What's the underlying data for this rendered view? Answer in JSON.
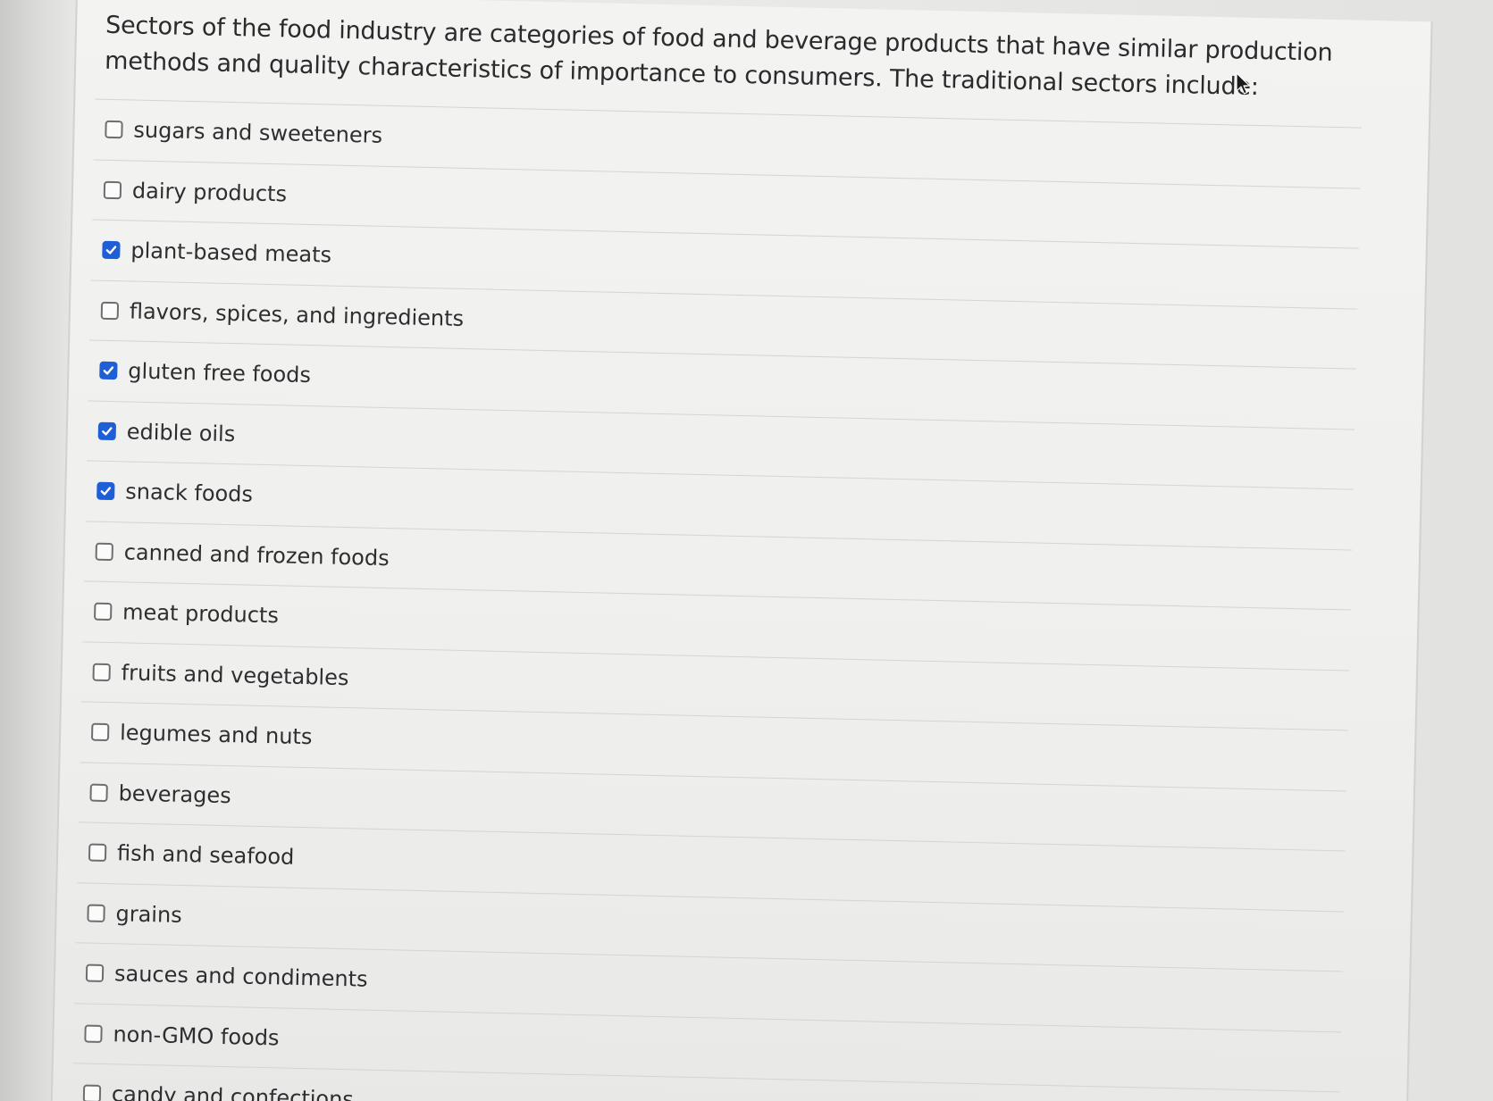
{
  "question": {
    "text": "Sectors of the food industry are categories of food and beverage products that have similar production methods and quality characteristics of importance to consumers.  The traditional sectors include:"
  },
  "options": [
    {
      "label": "sugars and sweeteners",
      "checked": false
    },
    {
      "label": "dairy products",
      "checked": false
    },
    {
      "label": "plant-based meats",
      "checked": true
    },
    {
      "label": "flavors, spices, and ingredients",
      "checked": false
    },
    {
      "label": "gluten free foods",
      "checked": true
    },
    {
      "label": "edible oils",
      "checked": true
    },
    {
      "label": "snack foods",
      "checked": true
    },
    {
      "label": "canned and frozen foods",
      "checked": false
    },
    {
      "label": "meat products",
      "checked": false
    },
    {
      "label": "fruits and vegetables",
      "checked": false
    },
    {
      "label": "legumes and nuts",
      "checked": false
    },
    {
      "label": "beverages",
      "checked": false
    },
    {
      "label": "fish and seafood",
      "checked": false
    },
    {
      "label": "grains",
      "checked": false
    },
    {
      "label": "sauces and condiments",
      "checked": false
    },
    {
      "label": "non-GMO foods",
      "checked": false
    },
    {
      "label": "candy and confections",
      "checked": false
    }
  ],
  "colors": {
    "checkbox_checked": "#1f5fd6",
    "text": "#2e2e30"
  },
  "cursor": {
    "icon": "mouse-pointer-icon"
  }
}
